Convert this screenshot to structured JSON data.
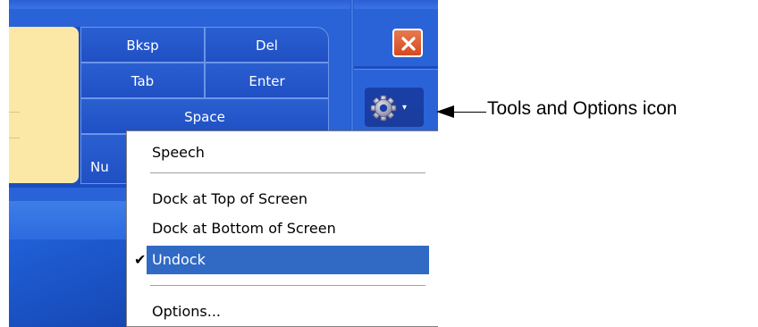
{
  "keyboard": {
    "keys": {
      "bksp": "Bksp",
      "del": "Del",
      "tab": "Tab",
      "enter": "Enter",
      "space": "Space",
      "num": "Nu"
    }
  },
  "window_controls": {
    "close_icon": "close-icon",
    "tools_icon": "gear-icon",
    "tools_caret": "▾"
  },
  "tools_menu": {
    "items": [
      {
        "label": "Speech",
        "checked": false,
        "selected": false
      },
      {
        "label": "Dock at Top of Screen",
        "checked": false,
        "selected": false
      },
      {
        "label": "Dock at Bottom of Screen",
        "checked": false,
        "selected": false
      },
      {
        "label": "Undock",
        "checked": true,
        "selected": true
      },
      {
        "label": "Options...",
        "checked": false,
        "selected": false
      }
    ],
    "check_glyph": "✔",
    "selection_color": "#316ac5"
  },
  "annotation": {
    "label": "Tools and Options icon"
  },
  "colors": {
    "taskbar_blue": "#1b4cc0",
    "close_red": "#d44a22",
    "panel_yellow": "#fbe8a6"
  }
}
